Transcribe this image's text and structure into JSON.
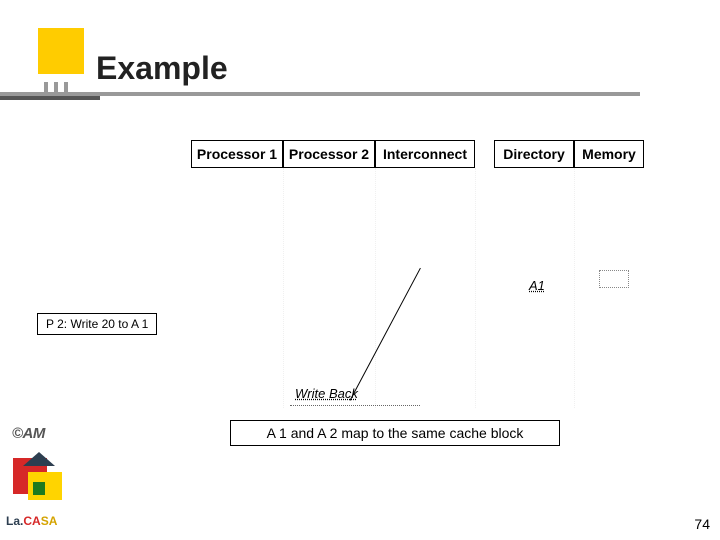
{
  "header": {
    "title": "Example"
  },
  "columns": {
    "p1": "Processor 1",
    "p2": "Processor 2",
    "interconnect": "Interconnect",
    "directory": "Directory",
    "memory": "Memory"
  },
  "directory_row": {
    "label": "A1"
  },
  "event_box": {
    "label": "P 2: Write 20 to A 1"
  },
  "interconnect_row": {
    "label": "Write Back"
  },
  "footer_note": "A 1 and A 2 map to the same cache block",
  "copyright": "©AM",
  "logo": {
    "la": "La.",
    "ca": "CA",
    "sa": "SA"
  },
  "page_number": "74"
}
